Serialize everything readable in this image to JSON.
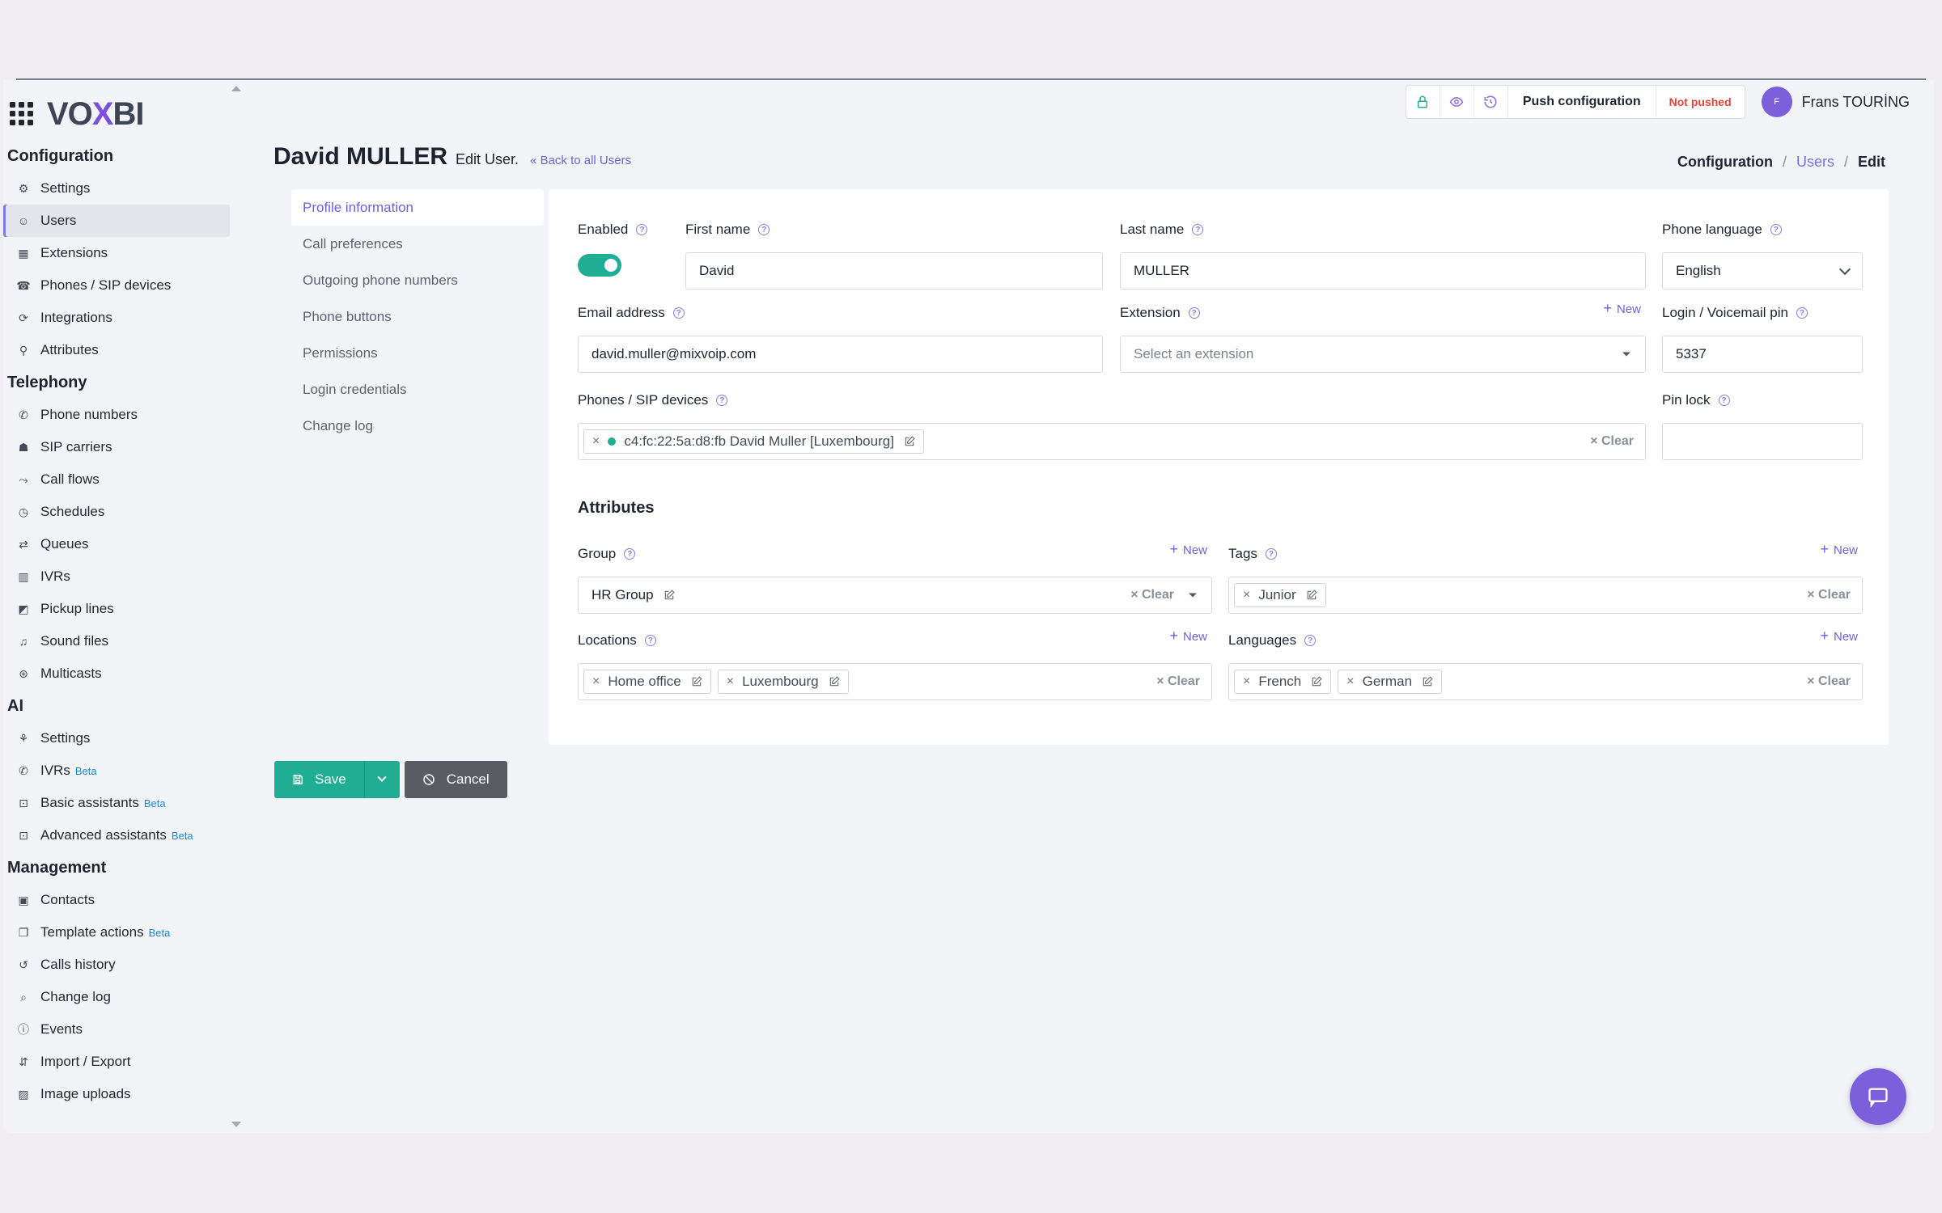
{
  "brand": {
    "logo_pre": "VO",
    "logo_x": "X",
    "logo_post": "BI",
    "accent": "#7c5fdb",
    "primary": "#1fae94"
  },
  "sidebar": {
    "sections": [
      {
        "title": "Configuration",
        "items": [
          {
            "label": "Settings",
            "icon": "gear-icon"
          },
          {
            "label": "Users",
            "icon": "user-icon",
            "active": true
          },
          {
            "label": "Extensions",
            "icon": "extension-icon"
          },
          {
            "label": "Phones / SIP devices",
            "icon": "phone-device-icon"
          },
          {
            "label": "Integrations",
            "icon": "integration-icon"
          },
          {
            "label": "Attributes",
            "icon": "attributes-icon"
          }
        ]
      },
      {
        "title": "Telephony",
        "items": [
          {
            "label": "Phone numbers",
            "icon": "phone-icon"
          },
          {
            "label": "SIP carriers",
            "icon": "carrier-icon"
          },
          {
            "label": "Call flows",
            "icon": "call-flow-icon"
          },
          {
            "label": "Schedules",
            "icon": "clock-icon"
          },
          {
            "label": "Queues",
            "icon": "queue-icon"
          },
          {
            "label": "IVRs",
            "icon": "ivr-icon"
          },
          {
            "label": "Pickup lines",
            "icon": "pickup-icon"
          },
          {
            "label": "Sound files",
            "icon": "music-icon"
          },
          {
            "label": "Multicasts",
            "icon": "broadcast-icon"
          }
        ]
      },
      {
        "title": "AI",
        "items": [
          {
            "label": "Settings",
            "icon": "ai-settings-icon"
          },
          {
            "label": "IVRs",
            "icon": "phone-ai-icon",
            "badge": "Beta"
          },
          {
            "label": "Basic assistants",
            "icon": "robot-icon",
            "badge": "Beta"
          },
          {
            "label": "Advanced assistants",
            "icon": "robot-icon",
            "badge": "Beta"
          }
        ]
      },
      {
        "title": "Management",
        "items": [
          {
            "label": "Contacts",
            "icon": "contacts-icon"
          },
          {
            "label": "Template actions",
            "icon": "template-icon",
            "badge": "Beta"
          },
          {
            "label": "Calls history",
            "icon": "history-icon"
          },
          {
            "label": "Change log",
            "icon": "search-icon"
          },
          {
            "label": "Events",
            "icon": "info-icon"
          },
          {
            "label": "Import / Export",
            "icon": "import-export-icon"
          },
          {
            "label": "Image uploads",
            "icon": "image-icon"
          }
        ]
      }
    ]
  },
  "topbar": {
    "push_label": "Push configuration",
    "status": "Not pushed",
    "user_initial": "F",
    "user_name": "Frans TOURİNG"
  },
  "page": {
    "title": "David MULLER",
    "subtitle": "Edit User.",
    "back_label": "Back to all Users",
    "breadcrumb": [
      "Configuration",
      "Users",
      "Edit"
    ]
  },
  "tabs": [
    "Profile information",
    "Call preferences",
    "Outgoing phone numbers",
    "Phone buttons",
    "Permissions",
    "Login credentials",
    "Change log"
  ],
  "form": {
    "enabled_label": "Enabled",
    "enabled": true,
    "first_name_label": "First name",
    "first_name": "David",
    "last_name_label": "Last name",
    "last_name": "MULLER",
    "phone_language_label": "Phone language",
    "phone_language": "English",
    "email_label": "Email address",
    "email": "david.muller@mixvoip.com",
    "extension_label": "Extension",
    "extension_placeholder": "Select an extension",
    "pin_label": "Login / Voicemail pin",
    "pin": "5337",
    "devices_label": "Phones / SIP devices",
    "devices": [
      "c4:fc:22:5a:d8:fb David Muller [Luxembourg]"
    ],
    "pin_lock_label": "Pin lock",
    "pin_lock": "",
    "new_label": "New",
    "clear_label": "× Clear"
  },
  "attributes": {
    "title": "Attributes",
    "group_label": "Group",
    "group": "HR Group",
    "tags_label": "Tags",
    "tags": [
      "Junior"
    ],
    "locations_label": "Locations",
    "locations": [
      "Home office",
      "Luxembourg"
    ],
    "languages_label": "Languages",
    "languages": [
      "French",
      "German"
    ]
  },
  "actions": {
    "save": "Save",
    "cancel": "Cancel"
  }
}
